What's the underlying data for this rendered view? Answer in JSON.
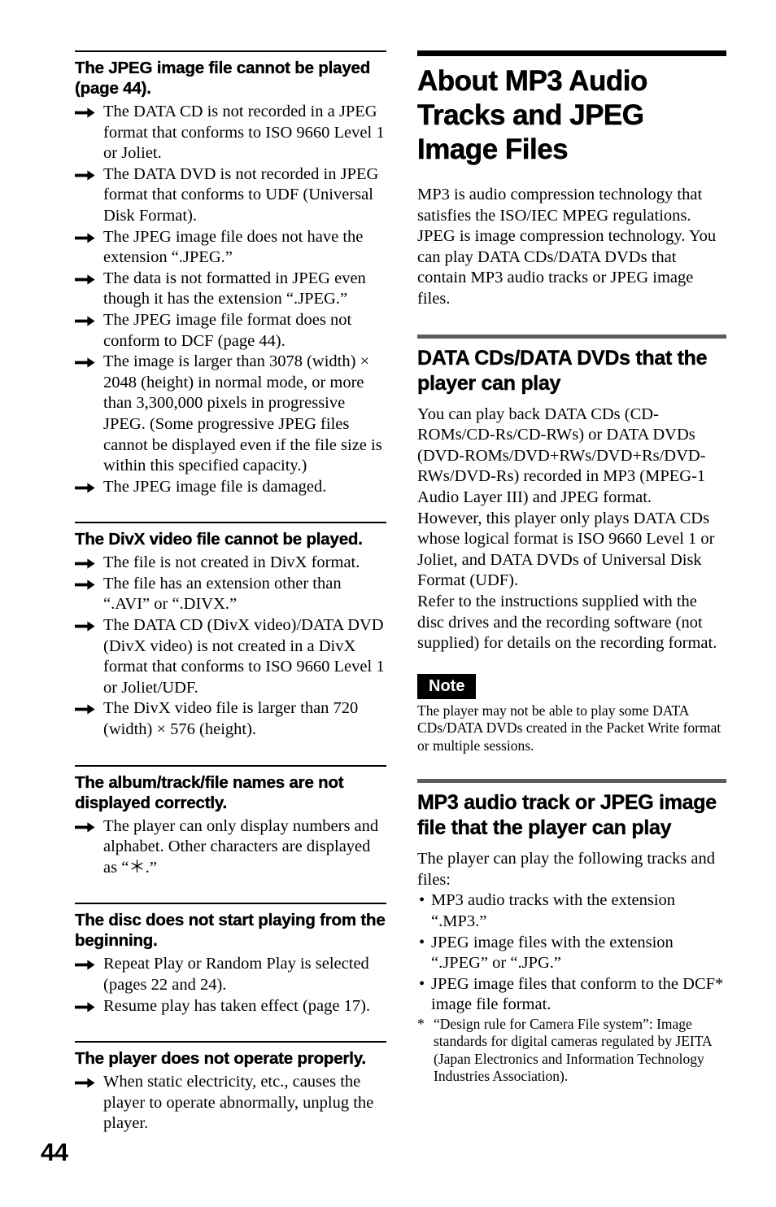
{
  "page_number": "44",
  "left_column": {
    "sections": [
      {
        "heading": "The JPEG image file cannot be played (page 44).",
        "items": [
          "The DATA CD is not recorded in a JPEG format that conforms to ISO 9660 Level 1 or Joliet.",
          "The DATA DVD is not recorded in JPEG format that conforms to UDF (Universal Disk Format).",
          "The JPEG image file does not have the extension “.JPEG.”",
          "The data is not formatted in JPEG even though it has the extension “.JPEG.”",
          "The JPEG image file format does not conform to DCF (page 44).",
          "The image is larger than 3078 (width) × 2048 (height) in normal mode, or more than 3,300,000 pixels in progressive JPEG. (Some progressive JPEG files cannot be displayed even if the file size is within this specified capacity.)",
          "The JPEG image file is damaged."
        ]
      },
      {
        "heading": "The DivX video file cannot be played.",
        "items": [
          "The file is not created in DivX format.",
          "The file has an extension other than “.AVI” or “.DIVX.”",
          "The DATA CD (DivX video)/DATA DVD (DivX video) is not created in a DivX format that conforms to ISO 9660 Level 1 or Joliet/UDF.",
          "The DivX video file is larger than 720 (width) × 576 (height)."
        ]
      },
      {
        "heading": "The album/track/file names are not displayed correctly.",
        "items": [
          "The player can only display numbers and alphabet. Other characters are displayed as “＊.”"
        ]
      },
      {
        "heading": "The disc does not start playing from the beginning.",
        "items": [
          "Repeat Play or Random Play is selected (pages 22 and 24).",
          "Resume play has taken effect (page 17)."
        ]
      },
      {
        "heading": "The player does not operate properly.",
        "items": [
          "When static electricity, etc., causes the player to operate abnormally, unplug the player."
        ]
      }
    ]
  },
  "right_column": {
    "title": "About MP3 Audio Tracks and JPEG Image Files",
    "intro": "MP3 is audio compression technology that satisfies the ISO/IEC MPEG regulations. JPEG is image compression technology. You can play DATA CDs/DATA DVDs that contain MP3 audio tracks or JPEG image files.",
    "section_data_discs": {
      "heading": "DATA CDs/DATA DVDs that the player can play",
      "paragraphs": [
        "You can play back DATA CDs (CD-ROMs/CD-Rs/CD-RWs) or DATA DVDs (DVD-ROMs/DVD+RWs/DVD+Rs/DVD-RWs/DVD-Rs) recorded in MP3 (MPEG-1 Audio Layer III) and JPEG format.",
        "However, this player only plays DATA CDs whose logical format is ISO 9660 Level 1 or Joliet, and DATA DVDs of Universal Disk Format (UDF).",
        "Refer to the instructions supplied with the disc drives and the recording software (not supplied) for details on the recording format."
      ],
      "note_label": "Note",
      "note_text": "The player may not be able to play some DATA CDs/DATA DVDs created in the Packet Write format or multiple sessions."
    },
    "section_playable_files": {
      "heading": "MP3 audio track or JPEG image file that the player can play",
      "lead": "The player can play the following tracks and files:",
      "bullets": [
        "MP3 audio tracks with the extension “.MP3.”",
        "JPEG image files with the extension “.JPEG” or “.JPG.”",
        "JPEG image files that conform to the DCF* image file format."
      ],
      "footnote_marker": "*",
      "footnote_text": "“Design rule for Camera File system”: Image standards for digital cameras regulated by JEITA (Japan Electronics and Information Technology Industries Association)."
    }
  },
  "colors": {
    "text": "#000000",
    "rule_black": "#000000",
    "rule_gray": "#5e5e5c",
    "note_badge_bg": "#000000",
    "note_badge_text": "#ffffff"
  }
}
